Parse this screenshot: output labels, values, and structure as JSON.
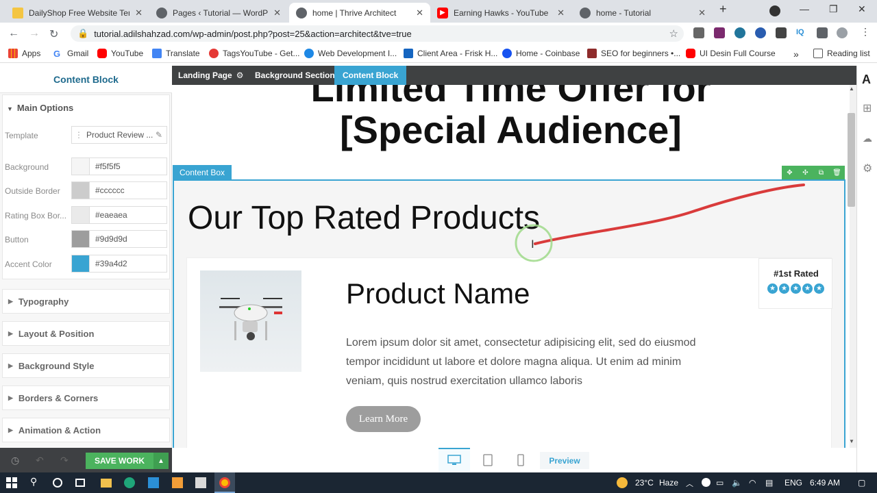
{
  "browser": {
    "tabs": [
      {
        "title": "DailyShop Free Website Temp",
        "active": false
      },
      {
        "title": "Pages ‹ Tutorial — WordPress",
        "active": false
      },
      {
        "title": "home | Thrive Architect",
        "active": true
      },
      {
        "title": "Earning Hawks - YouTube",
        "active": false
      },
      {
        "title": "home - Tutorial",
        "active": false
      }
    ],
    "url": "tutorial.adilshahzad.com/wp-admin/post.php?post=25&action=architect&tve=true",
    "bookmarks": [
      "Apps",
      "Gmail",
      "YouTube",
      "Translate",
      "TagsYouTube - Get...",
      "Web Development I...",
      "Client Area - Frisk H...",
      "Home - Coinbase",
      "SEO for beginners •...",
      "UI Desin Full Course"
    ],
    "reading_list": "Reading list",
    "more_glyph": "»"
  },
  "sidebar": {
    "title": "Content Block",
    "main_options": "Main Options",
    "template_label": "Template",
    "template_value": "Product Review ...",
    "options": [
      {
        "label": "Background",
        "value": "#f5f5f5",
        "color": "#f5f5f5"
      },
      {
        "label": "Outside Border",
        "value": "#cccccc",
        "color": "#cccccc"
      },
      {
        "label": "Rating Box Bor...",
        "value": "#eaeaea",
        "color": "#eaeaea"
      },
      {
        "label": "Button",
        "value": "#9d9d9d",
        "color": "#9d9d9d"
      },
      {
        "label": "Accent Color",
        "value": "#39a4d2",
        "color": "#39a4d2"
      }
    ],
    "sections": [
      "Typography",
      "Layout & Position",
      "Background Style",
      "Borders & Corners",
      "Animation & Action"
    ],
    "save_label": "SAVE WORK"
  },
  "breadcrumb": [
    "Landing Page",
    "Background Section",
    "Content Block"
  ],
  "canvas": {
    "hero_line1": "Limited Time Offer for",
    "hero_line2": "[Special Audience]",
    "content_box_tag": "Content Box",
    "section_heading": "Our Top Rated Products",
    "product_name": "Product Name",
    "product_desc": "Lorem ipsum dolor sit amet, consectetur adipisicing elit, sed do eiusmod tempor incididunt ut labore et dolore magna aliqua. Ut enim ad minim veniam, quis nostrud exercitation ullamco laboris",
    "learn_more": "Learn More",
    "rating_label": "#1st Rated",
    "stars": 5
  },
  "preview_label": "Preview",
  "taskbar": {
    "temperature": "23°C",
    "weather": "Haze",
    "language": "ENG",
    "time": "6:49 AM"
  },
  "colors": {
    "accent": "#39a4d2",
    "save": "#4bb35e",
    "button": "#9d9d9d"
  }
}
